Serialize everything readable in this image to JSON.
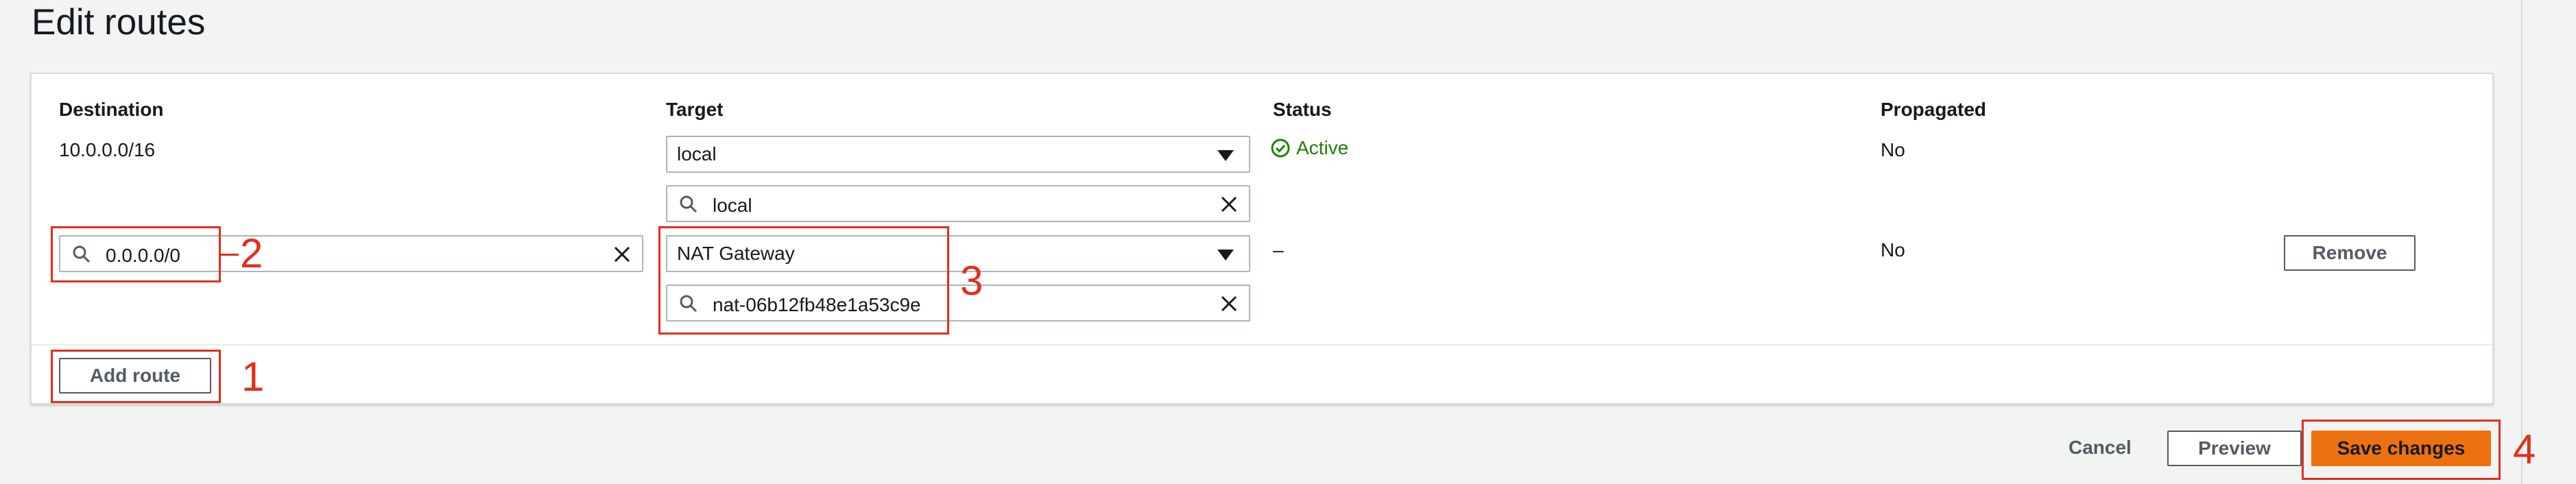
{
  "page": {
    "title": "Edit routes"
  },
  "columns": {
    "destination": "Destination",
    "target": "Target",
    "status": "Status",
    "propagated": "Propagated"
  },
  "routes": [
    {
      "destination": "10.0.0.0/16",
      "target_select": "local",
      "target_search": "local",
      "status": "Active",
      "propagated": "No"
    },
    {
      "destination_search": "0.0.0.0/0",
      "target_select": "NAT Gateway",
      "target_search": "nat-06b12fb48e1a53c9e",
      "status": "–",
      "propagated": "No",
      "remove_label": "Remove"
    }
  ],
  "actions": {
    "add_route": "Add route",
    "cancel": "Cancel",
    "preview": "Preview",
    "save": "Save changes"
  },
  "callouts": [
    "1",
    "2",
    "3",
    "4"
  ],
  "colors": {
    "highlight": "#e0301e",
    "primary": "#ec7211",
    "status_ok": "#1d8102"
  }
}
